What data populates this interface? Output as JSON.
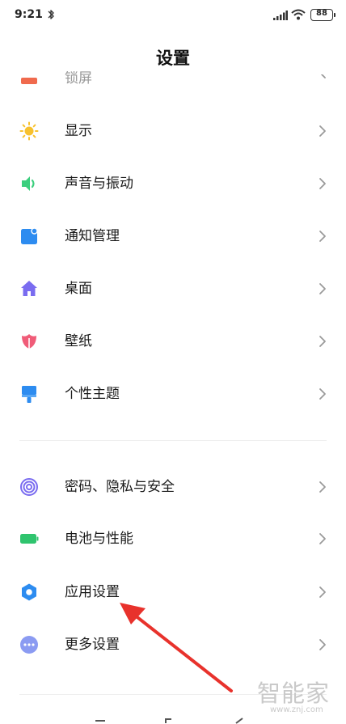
{
  "status_bar": {
    "time": "9:21",
    "battery": "88",
    "icons": [
      "bluetooth-icon",
      "signal-icon",
      "wifi-icon",
      "battery-icon"
    ]
  },
  "header": {
    "title": "设置"
  },
  "partial_item": {
    "label": "锁屏",
    "icon": "lock-screen-icon",
    "color": "#f06a4d"
  },
  "group1": [
    {
      "label": "显示",
      "icon": "sun-icon",
      "color": "#f7c12e"
    },
    {
      "label": "声音与振动",
      "icon": "speaker-icon",
      "color": "#3ccf7e"
    },
    {
      "label": "通知管理",
      "icon": "notification-icon",
      "color": "#2d8cf0"
    },
    {
      "label": "桌面",
      "icon": "home-icon",
      "color": "#7a6cf0"
    },
    {
      "label": "壁纸",
      "icon": "tulip-icon",
      "color": "#f05c78"
    },
    {
      "label": "个性主题",
      "icon": "paint-brush-icon",
      "color": "#2d8cf0"
    }
  ],
  "group2": [
    {
      "label": "密码、隐私与安全",
      "icon": "fingerprint-icon",
      "color": "#7a6cf0"
    },
    {
      "label": "电池与性能",
      "icon": "battery-green-icon",
      "color": "#2fc46e"
    },
    {
      "label": "应用设置",
      "icon": "gear-icon",
      "color": "#2d8cf0"
    },
    {
      "label": "更多设置",
      "icon": "more-icon",
      "color": "#8b9bf2"
    }
  ],
  "annotation": {
    "color": "#e8322c"
  },
  "watermark": {
    "text": "智能家",
    "url": "www.znj.com"
  }
}
